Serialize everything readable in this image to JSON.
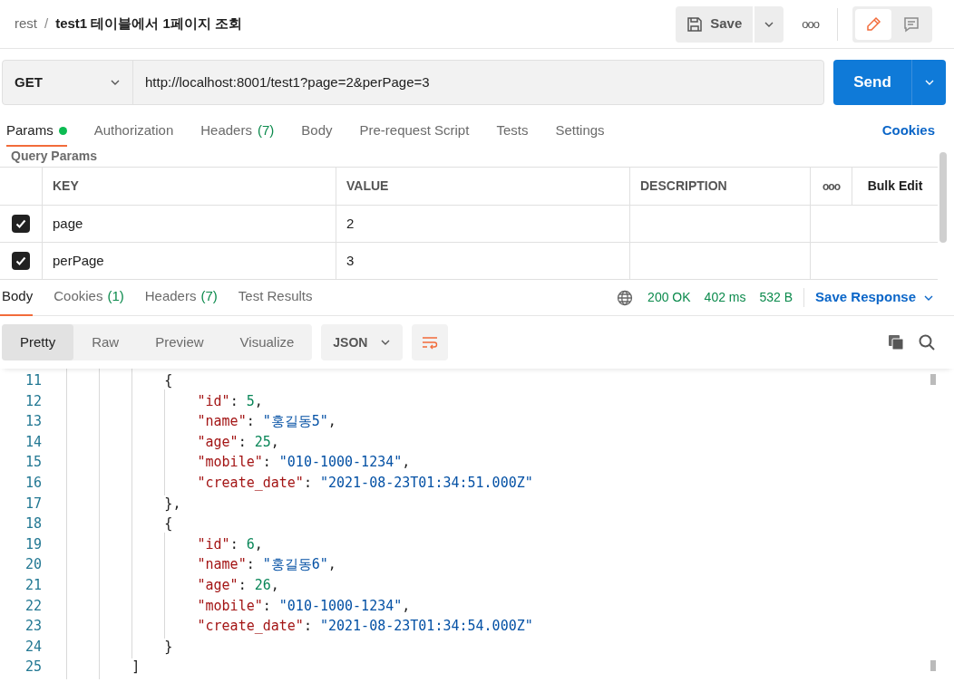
{
  "breadcrumb": {
    "collection": "rest",
    "separator": "/",
    "request": "test1 테이블에서 1페이지 조회"
  },
  "header_actions": {
    "save": "Save",
    "more": "ooo",
    "modes": [
      {
        "kind": "edit",
        "selected": true
      },
      {
        "kind": "comment",
        "selected": false
      }
    ]
  },
  "request": {
    "method": "GET",
    "url": "http://localhost:8001/test1?page=2&perPage=3",
    "send": "Send"
  },
  "request_tabs": [
    {
      "label": "Params",
      "dot": true,
      "selected": true
    },
    {
      "label": "Authorization",
      "selected": false
    },
    {
      "label": "Headers",
      "count": "(7)",
      "selected": false
    },
    {
      "label": "Body",
      "selected": false
    },
    {
      "label": "Pre-request Script",
      "selected": false
    },
    {
      "label": "Tests",
      "selected": false
    },
    {
      "label": "Settings",
      "selected": false
    }
  ],
  "cookies_link": "Cookies",
  "query_params": {
    "title": "Query Params",
    "columns": [
      "KEY",
      "VALUE",
      "DESCRIPTION"
    ],
    "more": "ooo",
    "bulk_edit": "Bulk Edit",
    "rows": [
      {
        "checked": true,
        "key": "page",
        "value": "2"
      },
      {
        "checked": true,
        "key": "perPage",
        "value": "3"
      }
    ]
  },
  "response_tabs": [
    {
      "label": "Body",
      "selected": true
    },
    {
      "label": "Cookies",
      "count": "(1)",
      "selected": false
    },
    {
      "label": "Headers",
      "count": "(7)",
      "selected": false
    },
    {
      "label": "Test Results",
      "selected": false
    }
  ],
  "response_meta": {
    "status": "200 OK",
    "time": "402 ms",
    "size": "532 B",
    "save_response": "Save Response"
  },
  "view_modes": [
    {
      "label": "Pretty",
      "selected": true
    },
    {
      "label": "Raw",
      "selected": false
    },
    {
      "label": "Preview",
      "selected": false
    },
    {
      "label": "Visualize",
      "selected": false
    }
  ],
  "format": "JSON",
  "code_lines": [
    {
      "number": "11",
      "tokens": [
        {
          "kind": "punct",
          "text": "            {"
        }
      ]
    },
    {
      "number": "12",
      "tokens": [
        {
          "kind": "key",
          "text": "                \"id\""
        },
        {
          "kind": "punct",
          "text": ": "
        },
        {
          "kind": "number",
          "text": "5"
        },
        {
          "kind": "punct",
          "text": ","
        }
      ]
    },
    {
      "number": "13",
      "tokens": [
        {
          "kind": "key",
          "text": "                \"name\""
        },
        {
          "kind": "punct",
          "text": ": "
        },
        {
          "kind": "string",
          "text": "\"홍길동5\""
        },
        {
          "kind": "punct",
          "text": ","
        }
      ]
    },
    {
      "number": "14",
      "tokens": [
        {
          "kind": "key",
          "text": "                \"age\""
        },
        {
          "kind": "punct",
          "text": ": "
        },
        {
          "kind": "number",
          "text": "25"
        },
        {
          "kind": "punct",
          "text": ","
        }
      ]
    },
    {
      "number": "15",
      "tokens": [
        {
          "kind": "key",
          "text": "                \"mobile\""
        },
        {
          "kind": "punct",
          "text": ": "
        },
        {
          "kind": "string",
          "text": "\"010-1000-1234\""
        },
        {
          "kind": "punct",
          "text": ","
        }
      ]
    },
    {
      "number": "16",
      "tokens": [
        {
          "kind": "key",
          "text": "                \"create_date\""
        },
        {
          "kind": "punct",
          "text": ": "
        },
        {
          "kind": "string",
          "text": "\"2021-08-23T01:34:51.000Z\""
        }
      ]
    },
    {
      "number": "17",
      "tokens": [
        {
          "kind": "punct",
          "text": "            },"
        }
      ]
    },
    {
      "number": "18",
      "tokens": [
        {
          "kind": "punct",
          "text": "            {"
        }
      ]
    },
    {
      "number": "19",
      "tokens": [
        {
          "kind": "key",
          "text": "                \"id\""
        },
        {
          "kind": "punct",
          "text": ": "
        },
        {
          "kind": "number",
          "text": "6"
        },
        {
          "kind": "punct",
          "text": ","
        }
      ]
    },
    {
      "number": "20",
      "tokens": [
        {
          "kind": "key",
          "text": "                \"name\""
        },
        {
          "kind": "punct",
          "text": ": "
        },
        {
          "kind": "string",
          "text": "\"홍길동6\""
        },
        {
          "kind": "punct",
          "text": ","
        }
      ]
    },
    {
      "number": "21",
      "tokens": [
        {
          "kind": "key",
          "text": "                \"age\""
        },
        {
          "kind": "punct",
          "text": ": "
        },
        {
          "kind": "number",
          "text": "26"
        },
        {
          "kind": "punct",
          "text": ","
        }
      ]
    },
    {
      "number": "22",
      "tokens": [
        {
          "kind": "key",
          "text": "                \"mobile\""
        },
        {
          "kind": "punct",
          "text": ": "
        },
        {
          "kind": "string",
          "text": "\"010-1000-1234\""
        },
        {
          "kind": "punct",
          "text": ","
        }
      ]
    },
    {
      "number": "23",
      "tokens": [
        {
          "kind": "key",
          "text": "                \"create_date\""
        },
        {
          "kind": "punct",
          "text": ": "
        },
        {
          "kind": "string",
          "text": "\"2021-08-23T01:34:54.000Z\""
        }
      ]
    },
    {
      "number": "24",
      "tokens": [
        {
          "kind": "punct",
          "text": "            }"
        }
      ]
    },
    {
      "number": "25",
      "tokens": [
        {
          "kind": "punct",
          "text": "        ]"
        }
      ]
    }
  ]
}
